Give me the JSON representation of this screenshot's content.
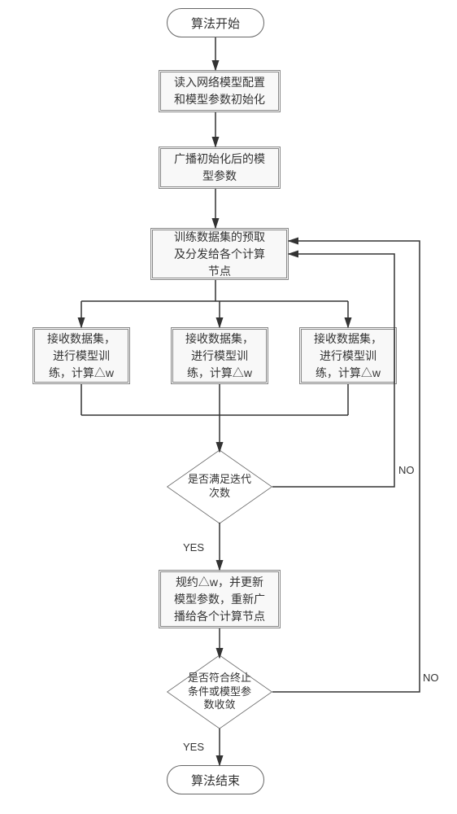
{
  "chart_data": {
    "type": "flowchart",
    "nodes": [
      {
        "id": "start",
        "shape": "terminator",
        "label": "算法开始"
      },
      {
        "id": "init",
        "shape": "process",
        "label": "读入网络模型配置\n和模型参数初始化"
      },
      {
        "id": "bcast",
        "shape": "process",
        "label": "广播初始化后的模\n型参数"
      },
      {
        "id": "prefetch",
        "shape": "process",
        "label": "训练数据集的预取\n及分发给各个计算\n节点"
      },
      {
        "id": "train1",
        "shape": "process",
        "label": "接收数据集，\n进行模型训\n练，计算△w"
      },
      {
        "id": "train2",
        "shape": "process",
        "label": "接收数据集，\n进行模型训\n练，计算△w"
      },
      {
        "id": "train3",
        "shape": "process",
        "label": "接收数据集，\n进行模型训\n练，计算△w"
      },
      {
        "id": "iter",
        "shape": "decision",
        "label": "是否满足迭代\n次数"
      },
      {
        "id": "reduce",
        "shape": "process",
        "label": "规约△w，并更新\n模型参数，重新广\n播给各个计算节点"
      },
      {
        "id": "stop",
        "shape": "decision",
        "label": "是否符合终止\n条件或模型参\n数收敛"
      },
      {
        "id": "end",
        "shape": "terminator",
        "label": "算法结束"
      }
    ],
    "edges": [
      {
        "from": "start",
        "to": "init"
      },
      {
        "from": "init",
        "to": "bcast"
      },
      {
        "from": "bcast",
        "to": "prefetch"
      },
      {
        "from": "prefetch",
        "to": "train1"
      },
      {
        "from": "prefetch",
        "to": "train2"
      },
      {
        "from": "prefetch",
        "to": "train3"
      },
      {
        "from": "train1",
        "to": "iter"
      },
      {
        "from": "train2",
        "to": "iter"
      },
      {
        "from": "train3",
        "to": "iter"
      },
      {
        "from": "iter",
        "to": "reduce",
        "label": "YES"
      },
      {
        "from": "iter",
        "to": "prefetch",
        "label": "NO"
      },
      {
        "from": "reduce",
        "to": "stop"
      },
      {
        "from": "stop",
        "to": "end",
        "label": "YES"
      },
      {
        "from": "stop",
        "to": "prefetch",
        "label": "NO"
      }
    ]
  },
  "labels": {
    "yes1": "YES",
    "yes2": "YES",
    "no1": "NO",
    "no2": "NO"
  }
}
